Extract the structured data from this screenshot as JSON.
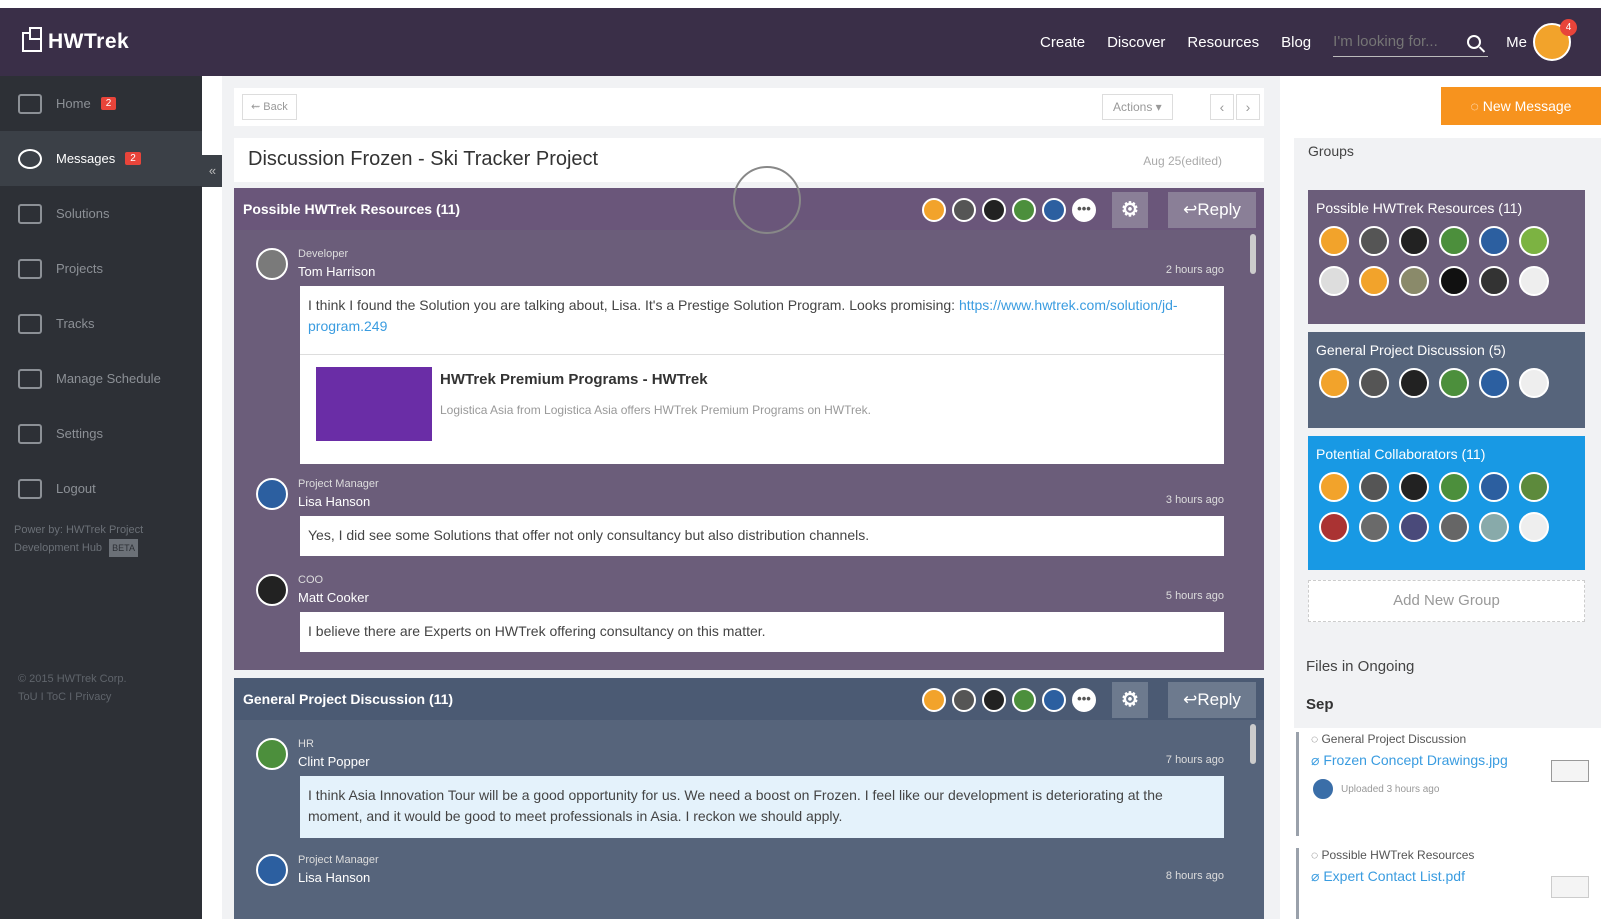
{
  "header": {
    "brand": "HWTrek",
    "nav": [
      "Create",
      "Discover",
      "Resources",
      "Blog"
    ],
    "search_placeholder": "I'm looking for...",
    "me_label": "Me",
    "notification_count": "4"
  },
  "sidebar": {
    "items": [
      {
        "label": "Home",
        "badge": "2"
      },
      {
        "label": "Messages",
        "badge": "2"
      },
      {
        "label": "Solutions"
      },
      {
        "label": "Projects"
      },
      {
        "label": "Tracks"
      },
      {
        "label": "Manage Schedule"
      },
      {
        "label": "Settings"
      },
      {
        "label": "Logout"
      }
    ],
    "collapse_glyph": "«",
    "powered_by": "Power by: HWTrek Project Development Hub",
    "beta": "BETA",
    "copyright": "© 2015 HWTrek Corp.",
    "links": "ToU  I  ToC   I Privacy"
  },
  "toolbar": {
    "back": "⇜ Back",
    "actions": "Actions ▾",
    "prev": "‹",
    "next": "›"
  },
  "discussion": {
    "title": "Discussion Frozen - Ski Tracker Project",
    "date": "Aug 25(edited)"
  },
  "panels": [
    {
      "title": "Possible HWTrek Resources (11)",
      "reply": "↩Reply",
      "gear": "⚙",
      "more": "•••",
      "messages": [
        {
          "role": "Developer",
          "name": "Tom Harrison",
          "time": "2 hours ago",
          "text": "I think I found the Solution you are talking about, Lisa. It's a Prestige Solution Program. Looks promising: ",
          "link": "https://www.hwtrek.com/solution/jd-program.249",
          "preview_title": "HWTrek Premium Programs - HWTrek",
          "preview_desc": "Logistica Asia from Logistica Asia offers HWTrek Premium Programs on HWTrek."
        },
        {
          "role": "Project Manager",
          "name": "Lisa Hanson",
          "time": "3 hours ago",
          "text": "Yes, I did see some Solutions that offer not only consultancy but also distribution channels."
        },
        {
          "role": "COO",
          "name": "Matt Cooker",
          "time": "5 hours ago",
          "text": "I believe there are Experts on HWTrek offering consultancy on this matter."
        }
      ]
    },
    {
      "title": "General Project Discussion (11)",
      "reply": "↩Reply",
      "gear": "⚙",
      "more": "•••",
      "messages": [
        {
          "role": "HR",
          "name": "Clint Popper",
          "time": "7 hours ago",
          "text": "I think Asia Innovation Tour will be a good opportunity for us. We need a boost on Frozen. I feel like our development is deteriorating at the moment, and it would be good to meet professionals in Asia. I reckon we should apply."
        },
        {
          "role": "Project Manager",
          "name": "Lisa Hanson",
          "time": "8 hours ago"
        }
      ]
    }
  ],
  "right": {
    "new_message": "New Message",
    "groups_heading": "Groups",
    "groups": [
      {
        "name": "Possible HWTrek Resources (11)"
      },
      {
        "name": "General Project Discussion (5)"
      },
      {
        "name": "Potential Collaborators (11)"
      }
    ],
    "add_group": "Add New Group",
    "files_heading": "Files in Ongoing",
    "month": "Sep",
    "files": [
      {
        "group": "General Project Discussion",
        "file": "Frozen Concept Drawings.jpg",
        "uploaded": "Uploaded 3 hours ago"
      },
      {
        "group": "Possible HWTrek Resources",
        "file": "Expert Contact List.pdf"
      }
    ]
  },
  "colors": {
    "header_bg": "#3a2f48",
    "sidebar_bg": "#2d3036",
    "accent_orange": "#f7931e",
    "accent_blue": "#1899e4",
    "panel1": "#6b5d7a",
    "panel2": "#56647b",
    "badge_red": "#e8443a"
  }
}
